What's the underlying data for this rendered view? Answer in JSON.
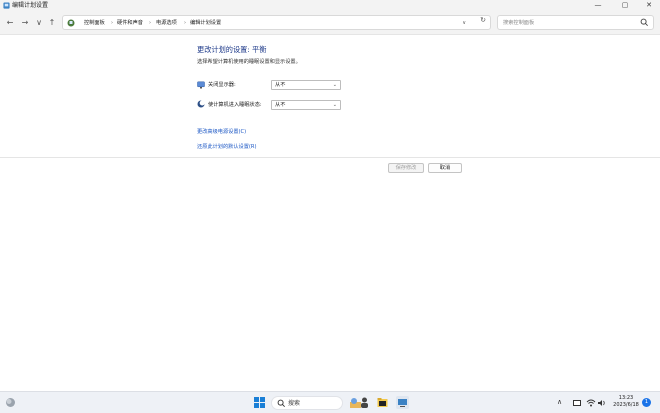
{
  "window": {
    "title": "编辑计划设置",
    "min": "—",
    "max": "▢",
    "close": "✕"
  },
  "nav": {
    "back": "←",
    "forward": "→",
    "recent": "∨",
    "up": "↑"
  },
  "breadcrumb": [
    "控制面板",
    "硬件和声音",
    "电源选项",
    "编辑计划设置"
  ],
  "breadcrumb_sep": "›",
  "address_dropdown": "∨",
  "refresh": "↻",
  "search": {
    "placeholder": "搜索控制面板"
  },
  "content": {
    "title": "更改计划的设置: 平衡",
    "subtitle": "选择希望计算机使用的睡眠设置和显示设置。",
    "settings": [
      {
        "label": "关闭显示器:",
        "value": "从不",
        "icon": "monitor-icon"
      },
      {
        "label": "使计算机进入睡眠状态:",
        "value": "从不",
        "icon": "moon-icon"
      }
    ],
    "links": [
      "更改高级电源设置(C)",
      "还原此计划的默认设置(R)"
    ],
    "save_label": "保存修改",
    "cancel_label": "取消"
  },
  "taskbar": {
    "search_label": "搜索",
    "time": "13:23",
    "date": "2023/6/18",
    "notification_count": "1",
    "tray_chevron": "∧"
  },
  "colors": {
    "accent": "#1a56c4",
    "title": "#1e3a8a",
    "taskbar": "#eef1f6"
  }
}
